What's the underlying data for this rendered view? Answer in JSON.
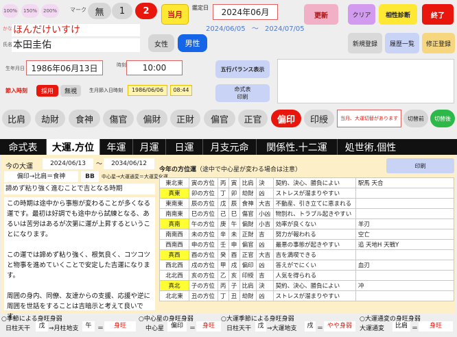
{
  "zoom": [
    "100%",
    "150%",
    "200%"
  ],
  "mark": {
    "label": "マーク",
    "options": [
      "無",
      "1",
      "2"
    ],
    "selected": "2"
  },
  "today_button": "当月",
  "appraisal": {
    "label": "鑑定日",
    "month": "2024年06月",
    "start": "2024/06/05",
    "tilde": "～",
    "end": "2024/07/05"
  },
  "buttons": {
    "update": "更新",
    "clear": "クリア",
    "compat": "相性診断",
    "exit": "終了",
    "new": "新規登録",
    "history": "履歴一覧",
    "edit": "修正登録",
    "balance": "五行バランス表示",
    "print_chart": "命式表\n印刷",
    "print": "印刷",
    "before": "切替前",
    "after": "切替後"
  },
  "person": {
    "kana_label": "かな",
    "kana": "ほんだけいすけ",
    "name_label": "氏名",
    "name": "本田圭佑",
    "gender": [
      "女性",
      "男性"
    ],
    "gender_selected": "男性"
  },
  "birth": {
    "label": "生年月日",
    "date": "1986年06月13日",
    "time_label": "時刻",
    "time": "10:00",
    "setsu_label": "節入時刻",
    "setsu_options": [
      "採用",
      "無視"
    ],
    "setsu_date_label": "生月節入日時刻",
    "setsu_date": "1986/06/06",
    "setsu_time": "08:44"
  },
  "elements": [
    "比肩",
    "劫財",
    "食神",
    "傷官",
    "偏財",
    "正財",
    "偏官",
    "正官",
    "偏印",
    "印綬"
  ],
  "element_selected": "偏印",
  "daiun_notice": "当月、大運切替があります",
  "tabs": [
    "命式表",
    "大運.方位",
    "年運",
    "月運",
    "日運",
    "月支元命",
    "関係性.十二運",
    "処世術.個性"
  ],
  "tab_selected": "大運.方位",
  "daiun": {
    "label": "今の大運",
    "from": "2024/06/13",
    "tilde": "～",
    "to": "2034/06/12",
    "formula": "偏印→比肩＝食神",
    "code": "BB",
    "note": "中心星→大運通変＝大運変化運",
    "title": "諦めず粘り強く進むことで吉となる時期",
    "text1": "この時期は途中から事態が変わることが多くなる運です。最初は好調でも途中から試練となる、あるいは苦労はあるが次第に運が上昇するということになります。",
    "text2": "この運では諦めず粘り強く、根気良く、コツコツと物事を進めていくことで安定した吉運になります。",
    "text3": "周囲の身内、同僚、友達からの支援、応援や逆に周囲を世話をすることは吉暗示と考えて良いです。"
  },
  "fortune": {
    "title": "今年の方位運",
    "subtitle": "（途中で中心星が変わる場合は注意）",
    "rows": [
      [
        "東北東",
        "寅の方位",
        "丙",
        "寅",
        "比肩",
        "決",
        "契約、決心、勝負によい",
        "駅馬 天合"
      ],
      [
        "真東",
        "卯の方位",
        "丁",
        "卯",
        "劫財",
        "凶",
        "ストレスが溜まりやすい",
        ""
      ],
      [
        "東南東",
        "辰の方位",
        "戊",
        "辰",
        "食神",
        "大吉",
        "不動産、引き立てに恵まれる",
        ""
      ],
      [
        "南南東",
        "巳の方位",
        "己",
        "巳",
        "傷官",
        "小凶",
        "物別れ、トラブル起きやすい",
        ""
      ],
      [
        "真南",
        "午の方位",
        "庚",
        "午",
        "偏財",
        "小吉",
        "効率が良くない",
        "羊刃"
      ],
      [
        "南南西",
        "未の方位",
        "辛",
        "未",
        "正財",
        "吉",
        "努力が報われる",
        "空亡"
      ],
      [
        "西南西",
        "申の方位",
        "壬",
        "申",
        "偏官",
        "凶",
        "最悪の事態が起きやすい",
        "追 天地H 天戦Y"
      ],
      [
        "真西",
        "酉の方位",
        "癸",
        "酉",
        "正官",
        "大吉",
        "吉を満喫できる",
        ""
      ],
      [
        "西北西",
        "戌の方位",
        "甲",
        "戌",
        "偏印",
        "凶",
        "答えがでにくい",
        "血刃"
      ],
      [
        "北北西",
        "亥の方位",
        "乙",
        "亥",
        "印綬",
        "吉",
        "人気を得られる",
        ""
      ],
      [
        "真北",
        "子の方位",
        "丙",
        "子",
        "比肩",
        "決",
        "契約、決心、勝負によい",
        "冲"
      ],
      [
        "北北東",
        "丑の方位",
        "丁",
        "丑",
        "劫財",
        "凶",
        "ストレスが溜まりやすい",
        ""
      ]
    ],
    "highlighted": [
      "真東",
      "真南",
      "真西",
      "真北"
    ]
  },
  "bottom": {
    "s1": {
      "title": "○季節による身旺身弱",
      "l1": "日柱天干",
      "v1": "戊",
      "arrow": "⇒月柱地支",
      "v2": "午",
      "eq": "＝",
      "res": "身旺"
    },
    "s2": {
      "title": "○中心星の身旺身弱",
      "l1": "中心星",
      "v1": "偏印",
      "eq": "＝",
      "res": "身旺"
    },
    "s3": {
      "title": "○大運季節による身旺身弱",
      "l1": "日柱天干",
      "v1": "戊",
      "arrow": "⇒大運地支",
      "v2": "戌",
      "eq": "＝",
      "res": "やや身弱"
    },
    "s4": {
      "title": "○大運通変の身旺身弱",
      "l1": "大運通変",
      "v1": "比肩",
      "eq": "＝",
      "res": "身旺"
    }
  },
  "colors": {
    "accent_red": "#e8160c",
    "blue": "#1565e8",
    "yellow_btn": "#ffe833",
    "purple": "#d39bf0",
    "tan": "#f7d680",
    "lavender": "#c9d3f5"
  }
}
